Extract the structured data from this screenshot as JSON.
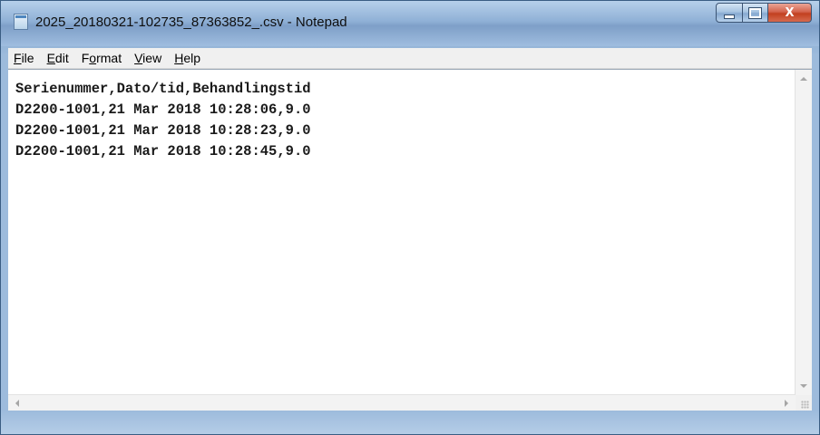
{
  "window": {
    "title": "2025_20180321-102735_87363852_.csv - Notepad",
    "app_icon": "notepad-icon",
    "buttons": {
      "minimize_icon": "minimize-icon",
      "maximize_icon": "maximize-icon",
      "close_icon": "close-icon",
      "close_glyph": "X"
    }
  },
  "menu": [
    {
      "pre": "",
      "ul": "F",
      "post": "ile"
    },
    {
      "pre": "",
      "ul": "E",
      "post": "dit"
    },
    {
      "pre": "F",
      "ul": "o",
      "post": "rmat"
    },
    {
      "pre": "",
      "ul": "V",
      "post": "iew"
    },
    {
      "pre": "",
      "ul": "H",
      "post": "elp"
    }
  ],
  "document": {
    "lines": [
      "Serienummer,Dato/tid,Behandlingstid",
      "D2200-1001,21 Mar 2018 10:28:06,9.0",
      "D2200-1001,21 Mar 2018 10:28:23,9.0",
      "D2200-1001,21 Mar 2018 10:28:45,9.0"
    ]
  },
  "colors": {
    "titlebar": "#8fb0d6",
    "close_button": "#c2401f",
    "menubar": "#f0f0f0",
    "editor_bg": "#ffffff"
  }
}
